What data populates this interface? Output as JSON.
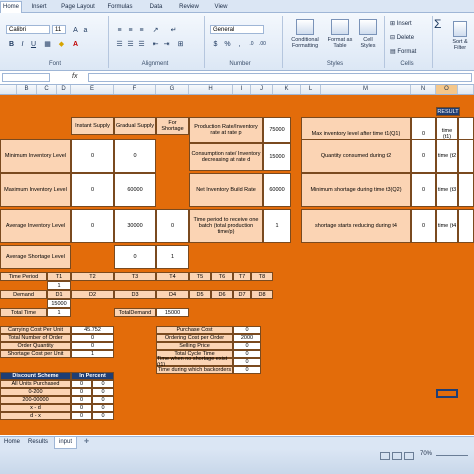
{
  "ribbon": {
    "tabs": [
      "Home",
      "Insert",
      "Page Layout",
      "Formulas",
      "Data",
      "Review",
      "View"
    ],
    "font_name": "Calibri",
    "font_size": "11",
    "number_format": "General",
    "groups": [
      "Font",
      "Alignment",
      "Number",
      "Styles",
      "Cells"
    ],
    "styles_buttons": [
      "Conditional Formatting",
      "Format as Table",
      "Cell Styles"
    ],
    "cells_buttons": [
      "Insert",
      "Delete",
      "Format"
    ],
    "editing_button": "Sort & Filter",
    "fx": "fx"
  },
  "columns": [
    "B",
    "C",
    "D",
    "E",
    "F",
    "G",
    "H",
    "I",
    "J",
    "K",
    "L",
    "M",
    "N",
    "O"
  ],
  "result_label": "RESULT",
  "main_headers": [
    "Instant Supply",
    "Gradual Supply",
    "For Shortage"
  ],
  "main_rows": [
    {
      "label": "Minimum Inventory Level",
      "instant": "0",
      "gradual": "0",
      "shortage": ""
    },
    {
      "label": "Maximum Inventory Level",
      "instant": "0",
      "gradual": "60000",
      "shortage": ""
    },
    {
      "label": "Average Inventory Level",
      "instant": "0",
      "gradual": "30000",
      "shortage": "0"
    },
    {
      "label": "Average Shortage Level",
      "instant": "",
      "gradual": "0",
      "shortage": "1"
    }
  ],
  "production_rows": [
    {
      "label": "Production Rate/Inventory rate at rate p",
      "value": "75000"
    },
    {
      "label": "Consumption rate/ Inventory decreasing at rate d",
      "value": "15000"
    },
    {
      "label": "Net Inventory Build Rate",
      "value": "60000"
    },
    {
      "label": "Time period to receive one batch (total production time/p)",
      "value": "1"
    }
  ],
  "right_rows": [
    {
      "label": "Max inventory level after time t1(Q1)",
      "value": "0",
      "time": "time (t1)"
    },
    {
      "label": "Quantity consumed during t2",
      "value": "0",
      "time": "time (t2"
    },
    {
      "label": "Minimum shortage during time t3(Q2)",
      "value": "0",
      "time": "time (t3"
    },
    {
      "label": "shortage starts reducing during t4",
      "value": "0",
      "time": "time (t4"
    }
  ],
  "time_period": {
    "label": "Time Period",
    "t_headers": [
      "T1",
      "T2",
      "T3",
      "T4",
      "T5",
      "T6",
      "T7",
      "T8"
    ],
    "t1_value": "1",
    "demand_label": "Demand",
    "d_headers": [
      "D1",
      "D2",
      "D3",
      "D4",
      "D5",
      "D6",
      "D7",
      "D8"
    ],
    "d1_value": "15000",
    "total_time_label": "Total Time",
    "total_time_value": "1",
    "total_demand_label": "TotalDemand",
    "total_demand_value": "15000"
  },
  "carrying": [
    {
      "label": "Carrying Cost Per Unit",
      "value": "45.752"
    },
    {
      "label": "Total Number of Order",
      "value": "0"
    },
    {
      "label": "Order Quantity",
      "value": "0"
    },
    {
      "label": "Shortage Cost per Unit",
      "value": "1"
    }
  ],
  "purchase": [
    {
      "label": "Purchase Cost",
      "value": "0"
    },
    {
      "label": "Ordering Cost per Order",
      "value": "2000"
    },
    {
      "label": "Selling Price",
      "value": "0"
    },
    {
      "label": "Total Cycle Time",
      "value": "0"
    },
    {
      "label": "Time when no shortage exist (t1)",
      "value": "0"
    },
    {
      "label": "Time during which backorders",
      "value": "0"
    }
  ],
  "discount": {
    "header": "Discount Scheme",
    "col": "In Percent",
    "rows": [
      {
        "label": "All Units Purchased",
        "a": "0",
        "b": "0"
      },
      {
        "label": "0-200",
        "a": "0",
        "b": "0"
      },
      {
        "label": "200-00000",
        "a": "0",
        "b": "0"
      },
      {
        "label": "x - d",
        "a": "0",
        "b": "0"
      },
      {
        "label": "d - x",
        "a": "0",
        "b": "0"
      }
    ]
  },
  "sheets": [
    "Home",
    "Results",
    "input"
  ],
  "zoom": "70%"
}
